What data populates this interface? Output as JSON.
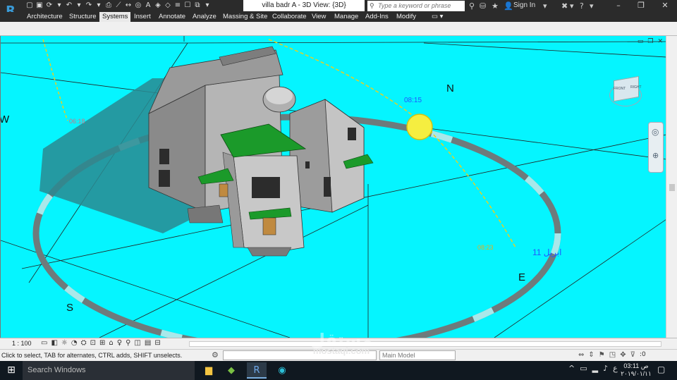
{
  "window": {
    "title": "villa badr A - 3D View: {3D}",
    "search_placeholder": "Type a keyword or phrase",
    "signin_label": "Sign In",
    "minimize": "–",
    "restore": "❐",
    "close": "✕"
  },
  "ribbon": {
    "tabs": [
      {
        "label": "Architecture"
      },
      {
        "label": "Structure"
      },
      {
        "label": "Systems"
      },
      {
        "label": "Insert"
      },
      {
        "label": "Annotate"
      },
      {
        "label": "Analyze"
      },
      {
        "label": "Massing & Site"
      },
      {
        "label": "Collaborate"
      },
      {
        "label": "View"
      },
      {
        "label": "Manage"
      },
      {
        "label": "Add-Ins"
      },
      {
        "label": "Modify"
      }
    ],
    "active_tab": "Systems"
  },
  "viewport": {
    "background": "#05f5ff",
    "compass": {
      "north": "N",
      "south": "S",
      "east": "E",
      "west": "W"
    },
    "sun_time_label": "08:15",
    "sun_path_labels": [
      "08:15",
      "06:18",
      "08:23"
    ],
    "date_label": "11 ابريل",
    "viewcube": {
      "front": "FRONT",
      "right": "RIGHT"
    }
  },
  "viewbar": {
    "scale": "1 : 100"
  },
  "statusbar": {
    "message": "Click to select, TAB for alternates, CTRL adds, SHIFT unselects.",
    "model_label": "Main Model",
    "filter_count": ":0"
  },
  "taskbar": {
    "search_text": "Search Windows",
    "time": "03:11 ص",
    "date": "٢٠١٩/٠١/١١",
    "lang": "ع"
  },
  "watermark": {
    "arabic": "مستقل",
    "latin": "mostaqi.com"
  }
}
